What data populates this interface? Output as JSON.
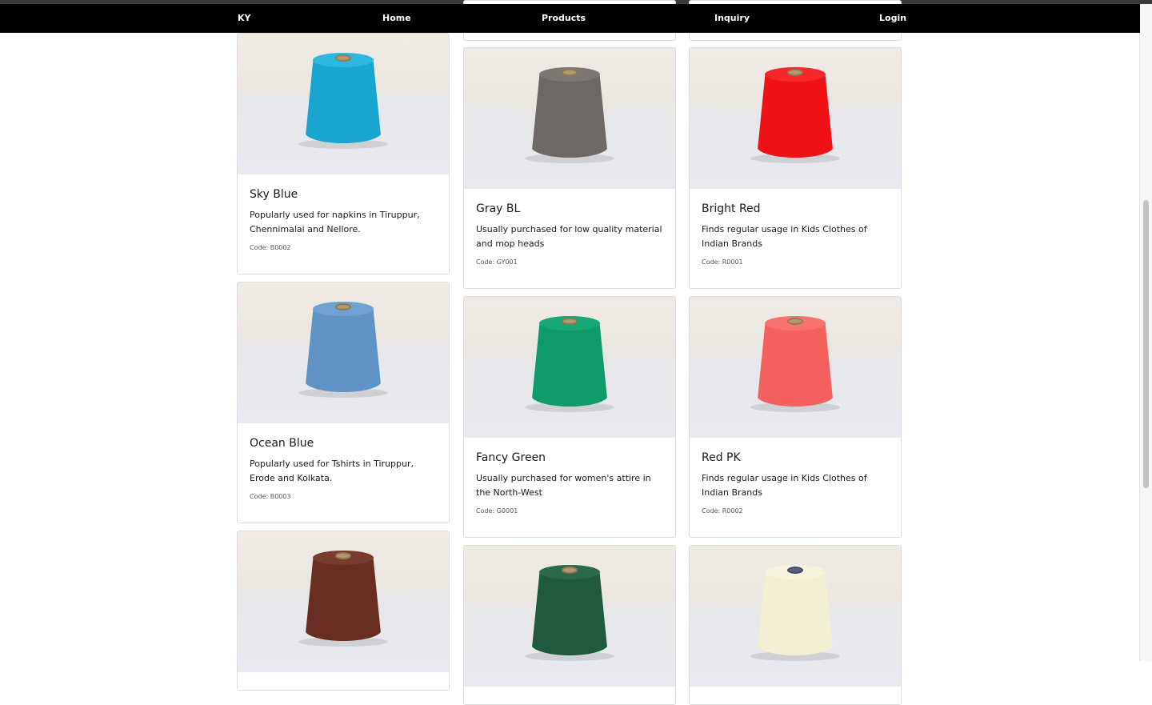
{
  "nav": {
    "brand": "KY",
    "home": "Home",
    "products": "Products",
    "inquiry": "Inquiry",
    "login": "Login"
  },
  "products": [
    {
      "name": "Sky Blue",
      "desc": "Popularly used for napkins in Tiruppur, Chennimalai and Nellore.",
      "code": "Code: B0002",
      "color": "#1aa5cf",
      "top_color": "#2db7df"
    },
    {
      "name": "Gray BL",
      "desc": "Usually purchased for low quality material and mop heads",
      "code": "Code: GY001",
      "color": "#6e6864",
      "top_color": "#7d7773"
    },
    {
      "name": "Bright Red",
      "desc": "Finds regular usage in Kids Clothes of Indian Brands",
      "code": "Code: R0001",
      "color": "#ee1115",
      "top_color": "#f5272b"
    },
    {
      "name": "Ocean Blue",
      "desc": "Popularly used for Tshirts in Tiruppur, Erode and Kolkata.",
      "code": "Code: B0003",
      "color": "#5f93c6",
      "top_color": "#6fa1d2"
    },
    {
      "name": "Fancy Green",
      "desc": "Usually purchased for women's attire in the North-West",
      "code": "Code: G0001",
      "color": "#0f9a6a",
      "top_color": "#17a877"
    },
    {
      "name": "Red PK",
      "desc": "Finds regular usage in Kids Clothes of Indian Brands",
      "code": "Code: R0002",
      "color": "#f4605e",
      "top_color": "#f77170"
    },
    {
      "name": "",
      "desc": "",
      "code": "",
      "color": "#6a2d22",
      "top_color": "#7a3b2f"
    },
    {
      "name": "",
      "desc": "",
      "code": "",
      "color": "#1f5a3e",
      "top_color": "#2a6a4b"
    },
    {
      "name": "",
      "desc": "",
      "code": "",
      "color": "#f1eed3",
      "top_color": "#f6f3dc"
    }
  ]
}
